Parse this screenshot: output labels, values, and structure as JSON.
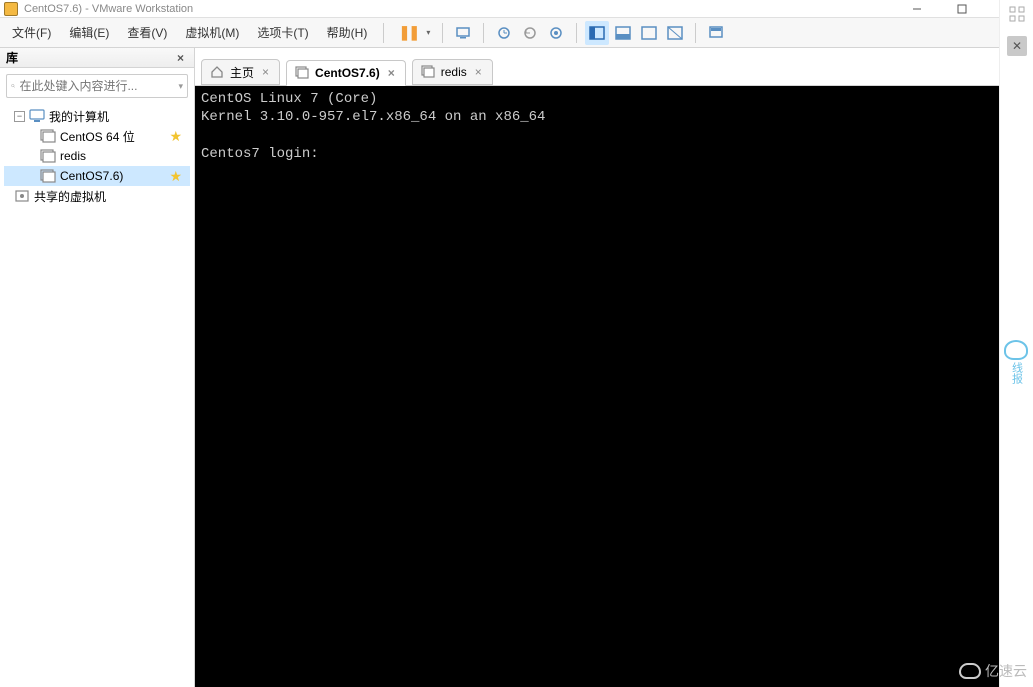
{
  "window": {
    "title": "CentOS7.6) - VMware Workstation"
  },
  "menu": {
    "file": "文件(F)",
    "edit": "编辑(E)",
    "view": "查看(V)",
    "vm": "虚拟机(M)",
    "tabs": "选项卡(T)",
    "help": "帮助(H)"
  },
  "sidebar": {
    "title": "库",
    "search_placeholder": "在此处键入内容进行...",
    "tree": {
      "root": "我的计算机",
      "items": [
        {
          "label": "CentOS 64 位",
          "fav": true
        },
        {
          "label": "redis",
          "fav": false
        },
        {
          "label": "CentOS7.6)",
          "fav": true,
          "selected": true
        }
      ],
      "shared": "共享的虚拟机"
    }
  },
  "tabs": {
    "home": "主页",
    "centos": "CentOS7.6)",
    "redis": "redis"
  },
  "console": {
    "line1": "CentOS Linux 7 (Core)",
    "line2": "Kernel 3.10.0-957.el7.x86_64 on an x86_64",
    "blank": "",
    "prompt": "Centos7 login:"
  },
  "float_badge": "线报",
  "watermark": "亿速云"
}
